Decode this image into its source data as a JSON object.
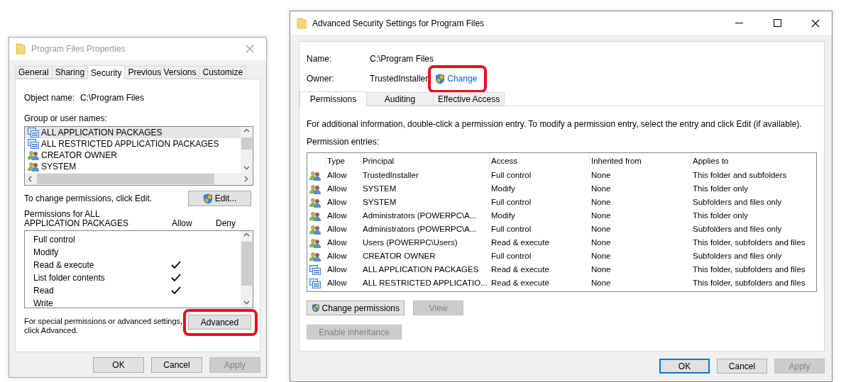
{
  "properties_window": {
    "title": "Program Files Properties",
    "active": false,
    "tabs": [
      {
        "label": "General",
        "selected": false
      },
      {
        "label": "Sharing",
        "selected": false
      },
      {
        "label": "Security",
        "selected": true
      },
      {
        "label": "Previous Versions",
        "selected": false
      },
      {
        "label": "Customize",
        "selected": false
      }
    ],
    "object_name": {
      "label": "Object name:",
      "value": "C:\\Program Files"
    },
    "group_label": "Group or user names:",
    "groups": [
      {
        "kind": "package",
        "name": "ALL APPLICATION PACKAGES",
        "selected": true
      },
      {
        "kind": "package",
        "name": "ALL RESTRICTED APPLICATION PACKAGES",
        "selected": false
      },
      {
        "kind": "users",
        "name": "CREATOR OWNER",
        "selected": false
      },
      {
        "kind": "users",
        "name": "SYSTEM",
        "selected": false
      }
    ],
    "edit_hint": "To change permissions, click Edit.",
    "edit_button": "Edit...",
    "permissions_for": "Permissions for ALL\nAPPLICATION PACKAGES",
    "allow_heading": "Allow",
    "deny_heading": "Deny",
    "permissions": [
      {
        "label": "Full control",
        "allow": false,
        "deny": false
      },
      {
        "label": "Modify",
        "allow": false,
        "deny": false
      },
      {
        "label": "Read & execute",
        "allow": true,
        "deny": false
      },
      {
        "label": "List folder contents",
        "allow": true,
        "deny": false
      },
      {
        "label": "Read",
        "allow": true,
        "deny": false
      },
      {
        "label": "Write",
        "allow": false,
        "deny": false
      }
    ],
    "advanced_hint": "For special permissions or advanced settings,\nclick Advanced.",
    "advanced_button": {
      "label": "Advanced",
      "highlighted": true
    },
    "buttons": [
      {
        "label": "OK",
        "disabled": false
      },
      {
        "label": "Cancel",
        "disabled": false
      },
      {
        "label": "Apply",
        "disabled": true
      }
    ]
  },
  "advanced_window": {
    "title": "Advanced Security Settings for Program Files",
    "active": true,
    "name": {
      "label": "Name:",
      "value": "C:\\Program Files"
    },
    "owner": {
      "label": "Owner:",
      "value": "TrustedInstaller",
      "link": "Change",
      "highlighted": true
    },
    "tabs": [
      {
        "label": "Permissions",
        "selected": true
      },
      {
        "label": "Auditing",
        "selected": false
      },
      {
        "label": "Effective Access",
        "selected": false
      }
    ],
    "info": "For additional information, double-click a permission entry. To modify a permission entry, select the entry and click Edit (if available).",
    "entries_label": "Permission entries:",
    "table": {
      "columns": [
        "Type",
        "Principal",
        "Access",
        "Inherited from",
        "Applies to"
      ],
      "rows": [
        {
          "kind": "users",
          "cells": [
            "Allow",
            "TrustedInstaller",
            "Full control",
            "None",
            "This folder and subfolders"
          ]
        },
        {
          "kind": "users",
          "cells": [
            "Allow",
            "SYSTEM",
            "Modify",
            "None",
            "This folder only"
          ]
        },
        {
          "kind": "users",
          "cells": [
            "Allow",
            "SYSTEM",
            "Full control",
            "None",
            "Subfolders and files only"
          ]
        },
        {
          "kind": "users",
          "cells": [
            "Allow",
            "Administrators (POWERPC\\A...",
            "Modify",
            "None",
            "This folder only"
          ]
        },
        {
          "kind": "users",
          "cells": [
            "Allow",
            "Administrators (POWERPC\\A...",
            "Full control",
            "None",
            "Subfolders and files only"
          ]
        },
        {
          "kind": "users",
          "cells": [
            "Allow",
            "Users (POWERPC\\Users)",
            "Read & execute",
            "None",
            "This folder, subfolders and files"
          ]
        },
        {
          "kind": "users",
          "cells": [
            "Allow",
            "CREATOR OWNER",
            "Full control",
            "None",
            "Subfolders and files only"
          ]
        },
        {
          "kind": "package",
          "cells": [
            "Allow",
            "ALL APPLICATION PACKAGES",
            "Read & execute",
            "None",
            "This folder, subfolders and files"
          ]
        },
        {
          "kind": "package",
          "cells": [
            "Allow",
            "ALL RESTRICTED APPLICATIO...",
            "Read & execute",
            "None",
            "This folder, subfolders and files"
          ]
        }
      ]
    },
    "actions": [
      {
        "label": "Change permissions",
        "shield": true,
        "disabled": false
      },
      {
        "label": "View",
        "shield": false,
        "disabled": true
      }
    ],
    "inheritance_button": {
      "label": "Enable inheritance",
      "disabled": true
    },
    "buttons": [
      {
        "label": "OK",
        "disabled": false,
        "default": true
      },
      {
        "label": "Cancel",
        "disabled": false,
        "default": false
      },
      {
        "label": "Apply",
        "disabled": true,
        "default": false
      }
    ]
  }
}
